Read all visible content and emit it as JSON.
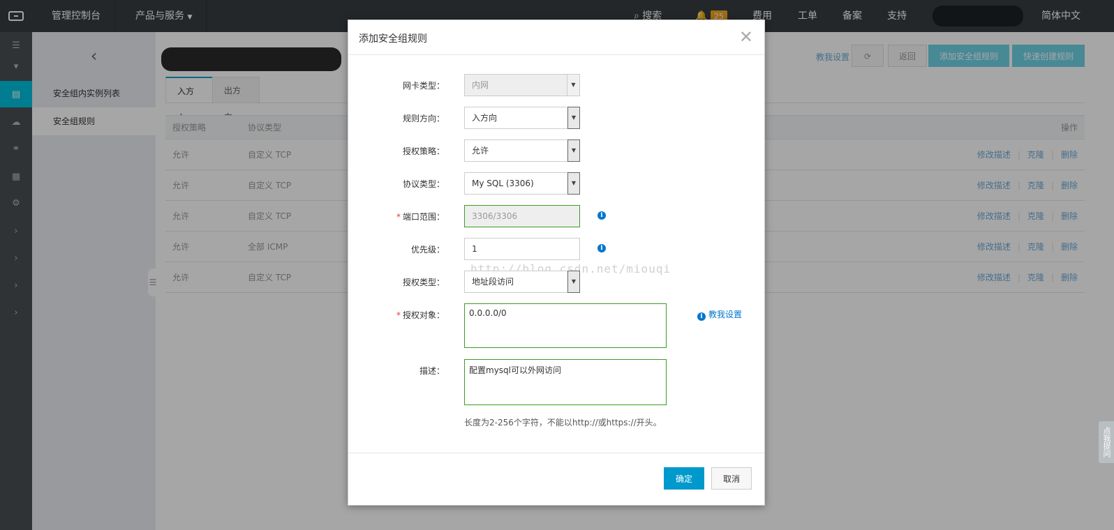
{
  "topbar": {
    "console": "管理控制台",
    "products": "产品与服务",
    "search": "搜索",
    "notification_count": "25",
    "billing": "费用",
    "tickets": "工单",
    "icp": "备案",
    "support": "支持",
    "language": "简体中文"
  },
  "subnav": {
    "items": [
      {
        "label": "安全组内实例列表"
      },
      {
        "label": "安全组规则"
      }
    ]
  },
  "main": {
    "teach_label": "教我设置",
    "back_label": "返回",
    "add_rule_label": "添加安全组规则",
    "quick_create_label": "快速创建规则",
    "tabs": [
      {
        "label": "入方向"
      },
      {
        "label": "出方向"
      }
    ],
    "table": {
      "headers": [
        "授权策略",
        "协议类型",
        "操作"
      ],
      "rows": [
        {
          "policy": "允许",
          "protocol": "自定义 TCP"
        },
        {
          "policy": "允许",
          "protocol": "自定义 TCP"
        },
        {
          "policy": "允许",
          "protocol": "自定义 TCP"
        },
        {
          "policy": "允许",
          "protocol": "全部 ICMP"
        },
        {
          "policy": "允许",
          "protocol": "自定义 TCP"
        }
      ],
      "ops": {
        "edit": "修改描述",
        "clone": "克隆",
        "delete": "删除"
      }
    }
  },
  "modal": {
    "title": "添加安全组规则",
    "fields": {
      "nic_type": {
        "label": "网卡类型：",
        "value": "内网"
      },
      "direction": {
        "label": "规则方向：",
        "value": "入方向"
      },
      "policy": {
        "label": "授权策略：",
        "value": "允许"
      },
      "protocol": {
        "label": "协议类型：",
        "value": "My SQL (3306)"
      },
      "port_range": {
        "label": "端口范围：",
        "value": "3306/3306"
      },
      "priority": {
        "label": "优先级：",
        "value": "1"
      },
      "auth_type": {
        "label": "授权类型：",
        "value": "地址段访问"
      },
      "auth_object": {
        "label": "授权对象：",
        "value": "0.0.0.0/0"
      },
      "description": {
        "label": "描述：",
        "value": "配置mysql可以外网访问"
      }
    },
    "help_text": "长度为2-256个字符，不能以http://或https://开头。",
    "teach_label": "教我设置",
    "watermark": "http://blog.csdn.net/miouqi",
    "confirm_label": "确定",
    "cancel_label": "取消"
  },
  "feedback_label": "点我提问"
}
